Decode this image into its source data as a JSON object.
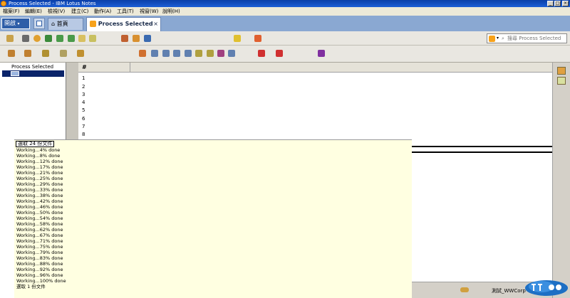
{
  "window": {
    "title": "Process Selected - IBM Lotus Notes",
    "controls": [
      "_",
      "□",
      "×"
    ],
    "accent": "#0a3fa8"
  },
  "menu": [
    "檔案(F)",
    "編輯(E)",
    "檢視(V)",
    "建立(C)",
    "動作(A)",
    "工具(T)",
    "視窗(W)",
    "說明(H)"
  ],
  "tabs": {
    "open_label": "開啟",
    "home_label": "首頁",
    "active_label": "Process Selected",
    "close_glyph": "×"
  },
  "search": {
    "placeholder": "搜尋 Process Selected"
  },
  "nav": {
    "title": "Process Selected"
  },
  "view": {
    "column_header": "#",
    "rows": [
      "1",
      "2",
      "3",
      "4",
      "5",
      "6",
      "7",
      "8"
    ]
  },
  "status": {
    "selection_label": "選取 24 份文件",
    "progress_lines": [
      "Working...4% done",
      "Working...8% done",
      "Working...12% done",
      "Working...17% done",
      "Working...21% done",
      "Working...25% done",
      "Working...29% done",
      "Working...33% done",
      "Working...38% done",
      "Working...42% done",
      "Working...46% done",
      "Working...50% done",
      "Working...54% done",
      "Working...58% done",
      "Working...62% done",
      "Working...67% done",
      "Working...71% done",
      "Working...75% done",
      "Working...79% done",
      "Working...83% done",
      "Working...88% done",
      "Working...92% done",
      "Working...96% done",
      "Working...100% done"
    ],
    "final_line": "選取 1 份文件",
    "statusbar_text": "測試_WWCorp"
  }
}
